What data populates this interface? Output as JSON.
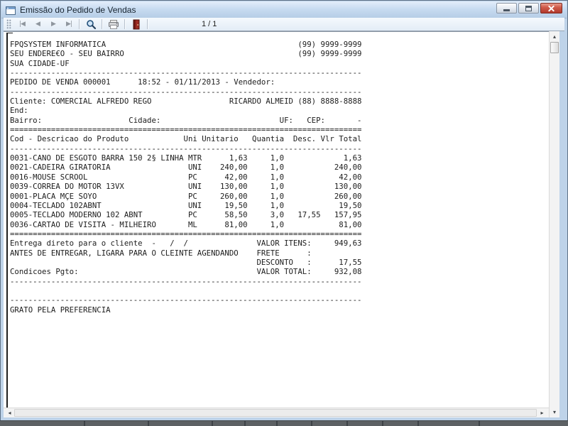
{
  "window": {
    "title": "Emissão do Pedido de Vendas"
  },
  "toolbar": {
    "nav_buttons": [
      {
        "id": "first-page",
        "glyph": "|◀"
      },
      {
        "id": "previous-page",
        "glyph": "◀"
      },
      {
        "id": "next-page",
        "glyph": "▶"
      },
      {
        "id": "last-page",
        "glyph": "▶|"
      }
    ],
    "page_indicator": "1 / 1"
  },
  "scrollbars": {
    "up_glyph": "▴",
    "down_glyph": "▾",
    "left_glyph": "◂",
    "right_glyph": "▸"
  },
  "colors": {
    "titlebar_blue": "#c6dbf0",
    "toolbar_bg": "#eef3fa",
    "close_button_red": "#c0463a",
    "magnifier_blue": "#1f4e79",
    "exit_door_red": "#9c2a21",
    "report_text": "#1c1c1c"
  },
  "report": {
    "width": 77,
    "lines": [
      [
        {
          "col": 1,
          "text": "FPQSYSTEM INFORMATICA"
        },
        {
          "col": 64,
          "text": "(99) 9999-9999"
        }
      ],
      [
        {
          "col": 1,
          "text": "SEU ENDERE€O - SEU BAIRRO"
        },
        {
          "col": 64,
          "text": "(99) 9999-9999"
        }
      ],
      [
        {
          "col": 1,
          "text": "SUA CIDADE-UF"
        }
      ],
      {
        "fill": "-"
      },
      [
        {
          "col": 1,
          "text": "PEDIDO DE VENDA 000001"
        },
        {
          "col": 29,
          "text": "18:52 - 01/11/2013 - Vendedor:"
        }
      ],
      {
        "fill": "-"
      },
      [
        {
          "col": 1,
          "text": "Cliente: COMERCIAL ALFREDO REGO"
        },
        {
          "col": 49,
          "text": "RICARDO ALMEID (88) 8888-8888"
        }
      ],
      [
        {
          "col": 1,
          "text": "End:"
        }
      ],
      [
        {
          "col": 1,
          "text": "Bairro:"
        },
        {
          "col": 27,
          "text": "Cidade:"
        },
        {
          "col": 60,
          "text": "UF:"
        },
        {
          "col": 66,
          "text": "CEP:"
        },
        {
          "col": 77,
          "text": "-"
        }
      ],
      {
        "fill": "="
      },
      [
        {
          "col": 1,
          "text": "Cod - Descricao do Produto"
        },
        {
          "col": 39,
          "text": "Uni Unitario"
        },
        {
          "col": 54,
          "text": "Quantia"
        },
        {
          "col": 63,
          "text": "Desc. Vlr Total"
        }
      ],
      {
        "fill": "-"
      },
      [
        {
          "col": 1,
          "text": "0031-CANO DE ESGOTO BARRA 150 2§ LINHA"
        },
        {
          "col": 40,
          "text": "MTR"
        },
        {
          "col": 49,
          "text": "1,63"
        },
        {
          "col": 58,
          "text": "1,0"
        },
        {
          "col": 74,
          "text": "1,63"
        }
      ],
      [
        {
          "col": 1,
          "text": "0021-CADEIRA GIRATORIA"
        },
        {
          "col": 40,
          "text": "UNI"
        },
        {
          "col": 47,
          "text": "240,00"
        },
        {
          "col": 58,
          "text": "1,0"
        },
        {
          "col": 72,
          "text": "240,00"
        }
      ],
      [
        {
          "col": 1,
          "text": "0016-MOUSE SCROOL"
        },
        {
          "col": 40,
          "text": "PC"
        },
        {
          "col": 48,
          "text": "42,00"
        },
        {
          "col": 58,
          "text": "1,0"
        },
        {
          "col": 73,
          "text": "42,00"
        }
      ],
      [
        {
          "col": 1,
          "text": "0039-CORREA DO MOTOR 13VX"
        },
        {
          "col": 40,
          "text": "UNI"
        },
        {
          "col": 47,
          "text": "130,00"
        },
        {
          "col": 58,
          "text": "1,0"
        },
        {
          "col": 72,
          "text": "130,00"
        }
      ],
      [
        {
          "col": 1,
          "text": "0001-PLACA MÇE SOYO"
        },
        {
          "col": 40,
          "text": "PC"
        },
        {
          "col": 47,
          "text": "260,00"
        },
        {
          "col": 58,
          "text": "1,0"
        },
        {
          "col": 72,
          "text": "260,00"
        }
      ],
      [
        {
          "col": 1,
          "text": "0004-TECLADO 102ABNT"
        },
        {
          "col": 40,
          "text": "UNI"
        },
        {
          "col": 48,
          "text": "19,50"
        },
        {
          "col": 58,
          "text": "1,0"
        },
        {
          "col": 73,
          "text": "19,50"
        }
      ],
      [
        {
          "col": 1,
          "text": "0005-TECLADO MODERNO 102 ABNT"
        },
        {
          "col": 40,
          "text": "PC"
        },
        {
          "col": 48,
          "text": "58,50"
        },
        {
          "col": 58,
          "text": "3,0"
        },
        {
          "col": 64,
          "text": "17,55"
        },
        {
          "col": 72,
          "text": "157,95"
        }
      ],
      [
        {
          "col": 1,
          "text": "0036-CARTAO DE VISITA - MILHEIRO"
        },
        {
          "col": 40,
          "text": "ML"
        },
        {
          "col": 48,
          "text": "81,00"
        },
        {
          "col": 58,
          "text": "1,0"
        },
        {
          "col": 73,
          "text": "81,00"
        }
      ],
      {
        "fill": "="
      },
      [
        {
          "col": 1,
          "text": "Entrega direto para o cliente  -   /  /"
        },
        {
          "col": 55,
          "text": "VALOR ITENS:"
        },
        {
          "col": 72,
          "text": "949,63"
        }
      ],
      [
        {
          "col": 1,
          "text": "ANTES DE ENTREGAR, LIGARA PARA O CLEINTE AGENDANDO"
        },
        {
          "col": 55,
          "text": "FRETE      :"
        }
      ],
      [
        {
          "col": 55,
          "text": "DESCONTO   :"
        },
        {
          "col": 73,
          "text": "17,55"
        }
      ],
      [
        {
          "col": 1,
          "text": "Condicoes Pgto:"
        },
        {
          "col": 55,
          "text": "VALOR TOTAL:"
        },
        {
          "col": 72,
          "text": "932,08"
        }
      ],
      {
        "fill": "-"
      },
      [],
      {
        "fill": "-"
      },
      [
        {
          "col": 1,
          "text": "GRATO PELA PREFERENCIA"
        }
      ]
    ]
  }
}
